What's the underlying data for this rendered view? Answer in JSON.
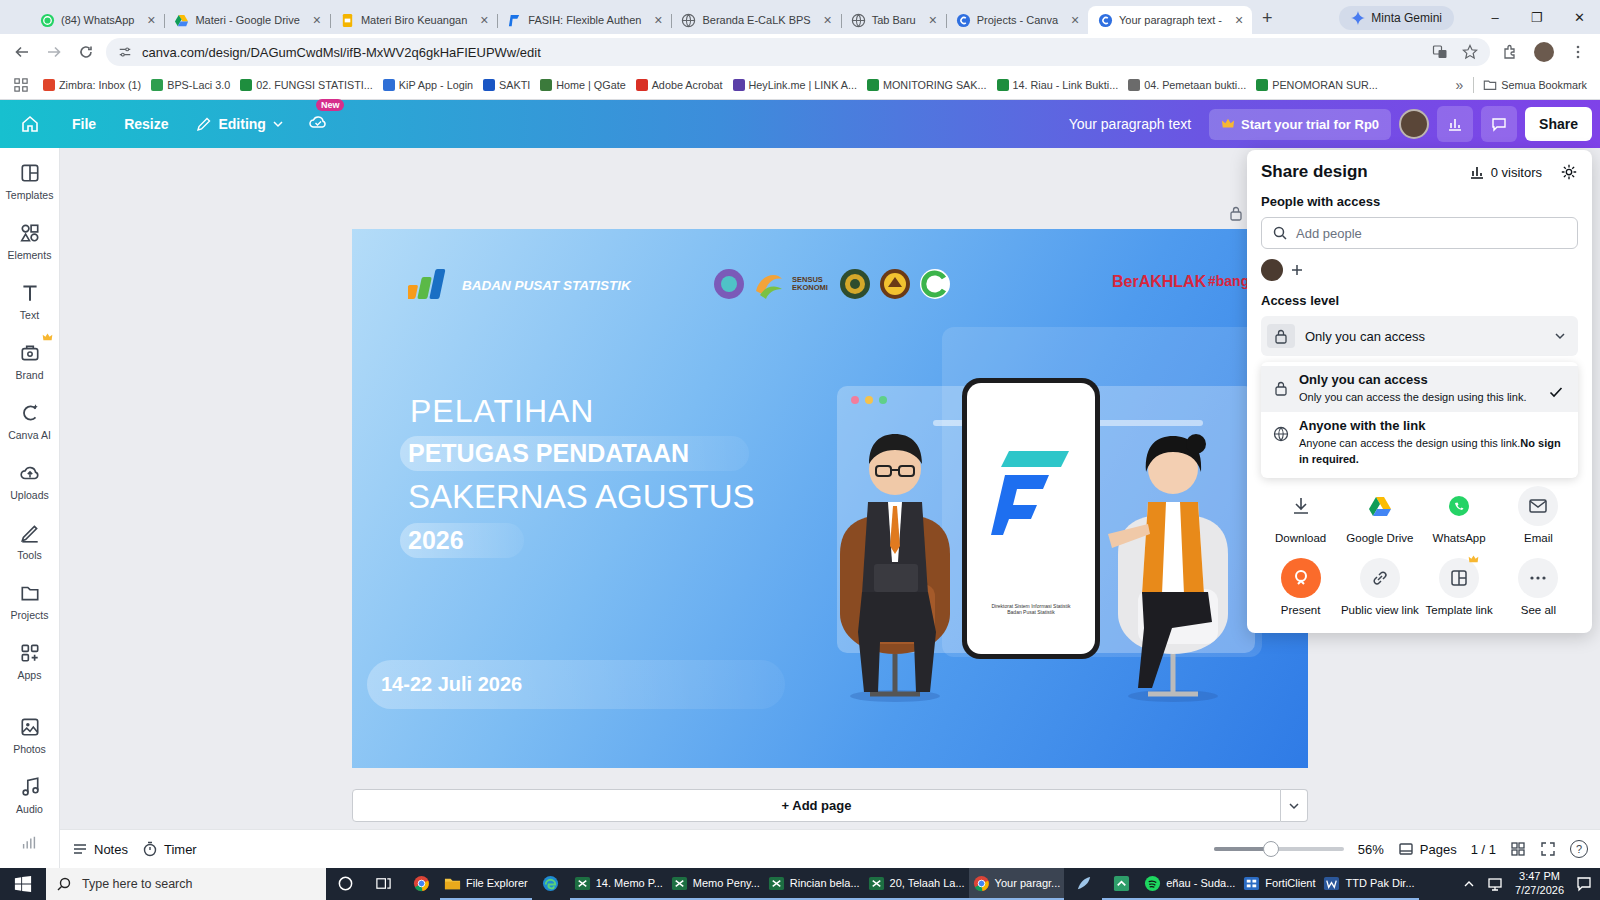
{
  "browser": {
    "tabs": [
      {
        "label": "(84) WhatsApp",
        "kind": "whatsapp",
        "selected": false
      },
      {
        "label": "Materi - Google Drive",
        "kind": "drive",
        "selected": false
      },
      {
        "label": "Materi Biro Keuangan",
        "kind": "slides",
        "selected": false
      },
      {
        "label": "FASIH: Flexible Authen",
        "kind": "fasih",
        "selected": false
      },
      {
        "label": "Beranda E-CaLK BPS",
        "kind": "globe",
        "selected": false
      },
      {
        "label": "Tab Baru",
        "kind": "globe",
        "selected": false
      },
      {
        "label": "Projects - Canva",
        "kind": "canva",
        "selected": false
      },
      {
        "label": "Your paragraph text -",
        "kind": "canva",
        "selected": true
      }
    ],
    "close": "×",
    "new_tab": "+",
    "gemini": "Minta Gemini",
    "window_controls": [
      "–",
      "❐",
      "✕"
    ],
    "url": "canva.com/design/DAGumCwdMsl/ifB-MxWV2q6gkHaFIEUPWw/edit",
    "bookmarks": [
      {
        "label": "Zimbra: Inbox (1)",
        "color": "#e0452b"
      },
      {
        "label": "BPS-Laci 3.0",
        "color": "#2e9e4f"
      },
      {
        "label": "02. FUNGSI STATISTI...",
        "color": "#1e8e3e"
      },
      {
        "label": "KiP App - Login",
        "color": "#2f6fd6"
      },
      {
        "label": "SAKTI",
        "color": "#1a56c4"
      },
      {
        "label": "Home | QGate",
        "color": "#3b7a3b"
      },
      {
        "label": "Adobe Acrobat",
        "color": "#d93025"
      },
      {
        "label": "HeyLink.me | LINK A...",
        "color": "#5b3fa8"
      },
      {
        "label": "MONITORING SAK...",
        "color": "#1e8e3e"
      },
      {
        "label": "14. Riau - Link Bukti...",
        "color": "#1e8e3e"
      },
      {
        "label": "04. Pemetaan bukti...",
        "color": "#6b6b6b"
      },
      {
        "label": "PENOMORAN SUR...",
        "color": "#1e8e3e"
      }
    ],
    "more": "»",
    "all_bookmarks": "Semua Bookmark"
  },
  "editor": {
    "menu": [
      "File",
      "Resize"
    ],
    "mode": "Editing",
    "new_badge": "New",
    "title": "Your paragraph text",
    "trial": "Start your trial for Rp0",
    "share": "Share"
  },
  "sidebar": {
    "items": [
      {
        "label": "Templates",
        "kind": "templates",
        "premium": false
      },
      {
        "label": "Elements",
        "kind": "elements",
        "premium": false
      },
      {
        "label": "Text",
        "kind": "text",
        "premium": false
      },
      {
        "label": "Brand",
        "kind": "brand",
        "premium": true
      },
      {
        "label": "Canva AI",
        "kind": "ai",
        "premium": false
      },
      {
        "label": "Uploads",
        "kind": "uploads",
        "premium": false
      },
      {
        "label": "Tools",
        "kind": "tools",
        "premium": false
      },
      {
        "label": "Projects",
        "kind": "projects",
        "premium": false
      },
      {
        "label": "Apps",
        "kind": "apps",
        "premium": false
      },
      {
        "label": "Photos",
        "kind": "photos",
        "premium": false
      },
      {
        "label": "Audio",
        "kind": "audio",
        "premium": false
      }
    ]
  },
  "slide": {
    "org": "BADAN PUSAT STATISTIK",
    "sensus": "SENSUS EKONOMI",
    "berakhlak": "BerAKHLAK",
    "hashtag": "#bangga",
    "kicker": "PELATIHAN",
    "lines": [
      {
        "text": "PETUGAS PENDATAAN",
        "highlighted": true,
        "size": "medium"
      },
      {
        "text": "SAKERNAS AGUSTUS",
        "highlighted": false,
        "size": "large"
      },
      {
        "text": "2026",
        "highlighted": true,
        "size": "medium"
      }
    ],
    "date": "14-22 Juli 2026",
    "app_caption": [
      "Direktorat Sistem Informasi Statistik",
      "Badan Pusat Statistik"
    ]
  },
  "canvas": {
    "add_page": "+ Add page"
  },
  "footer": {
    "notes": "Notes",
    "timer": "Timer",
    "zoom_level": 0.44,
    "zoom": "56%",
    "pages": "Pages",
    "page_count": "1 / 1",
    "help": "?"
  },
  "share_panel": {
    "title": "Share design",
    "visitors": "0 visitors",
    "people_label": "People with access",
    "add_people": "Add people",
    "access_label": "Access level",
    "access_value": "Only you can access",
    "options": [
      {
        "title": "Only you can access",
        "description": "Only you can access the design using this link.",
        "note": "",
        "kind": "lock",
        "selected": true
      },
      {
        "title": "Anyone with the link",
        "description": "Anyone can access the design using this link.",
        "note": "No sign in required.",
        "kind": "globe",
        "selected": false
      }
    ],
    "actions": [
      {
        "label": "Download",
        "kind": "download",
        "premium": false
      },
      {
        "label": "Google Drive",
        "kind": "drive",
        "premium": false
      },
      {
        "label": "WhatsApp",
        "kind": "whatsapp",
        "premium": false
      },
      {
        "label": "Email",
        "kind": "email",
        "premium": false
      },
      {
        "label": "Present",
        "kind": "present",
        "premium": false
      },
      {
        "label": "Public view link",
        "kind": "link",
        "premium": false
      },
      {
        "label": "Template link",
        "kind": "template",
        "premium": true
      },
      {
        "label": "See all",
        "kind": "more",
        "premium": false
      }
    ]
  },
  "taskbar": {
    "search": "Type here to search",
    "apps": [
      {
        "label": "",
        "kind": "cortana",
        "running": false,
        "active": false
      },
      {
        "label": "",
        "kind": "taskview",
        "running": false,
        "active": false
      },
      {
        "label": "",
        "kind": "chrome",
        "running": false,
        "active": false
      },
      {
        "label": "File Explorer",
        "kind": "explorer",
        "running": true,
        "active": false
      },
      {
        "label": "",
        "kind": "edge",
        "running": false,
        "active": false
      },
      {
        "label": "14. Memo P...",
        "kind": "excel",
        "running": true,
        "active": false
      },
      {
        "label": "Memo Peny...",
        "kind": "excel",
        "running": true,
        "active": false
      },
      {
        "label": "Rincian bela...",
        "kind": "excel",
        "running": true,
        "active": false
      },
      {
        "label": "20, Telaah La...",
        "kind": "excel",
        "running": true,
        "active": false
      },
      {
        "label": "Your paragr...",
        "kind": "chrome",
        "running": true,
        "active": true
      },
      {
        "label": "",
        "kind": "feather",
        "running": false,
        "active": false
      },
      {
        "label": "",
        "kind": "arrowapp",
        "running": true,
        "active": false
      },
      {
        "label": "eñau - Suda...",
        "kind": "spotify",
        "running": true,
        "active": false
      },
      {
        "label": "FortiClient",
        "kind": "forti",
        "running": true,
        "active": false
      },
      {
        "label": "TTD Pak Dir...",
        "kind": "word",
        "running": true,
        "active": false
      }
    ],
    "time": "3:47 PM",
    "date": "7/27/2026"
  }
}
